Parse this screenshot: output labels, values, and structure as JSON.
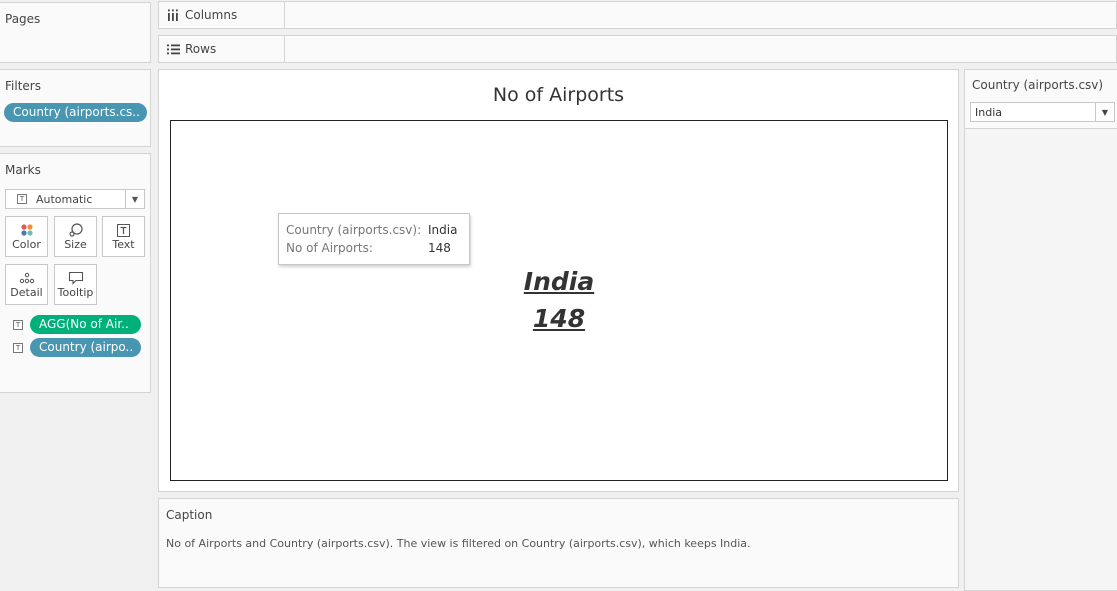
{
  "pages": {
    "title": "Pages"
  },
  "filters": {
    "title": "Filters",
    "pills": [
      {
        "label": "Country (airports.cs.."
      }
    ]
  },
  "marks": {
    "title": "Marks",
    "mark_type": "Automatic",
    "buttons": {
      "color": "Color",
      "size": "Size",
      "text": "Text",
      "detail": "Detail",
      "tooltip": "Tooltip"
    },
    "fields": [
      {
        "icon": "T",
        "label": "AGG(No of Air..",
        "color": "#00b07a"
      },
      {
        "icon": "T",
        "label": "Country (airpo..",
        "color": "#4996b2"
      }
    ]
  },
  "shelves": {
    "columns": "Columns",
    "rows": "Rows"
  },
  "viz": {
    "title": "No of Airports",
    "mark": {
      "country": "India",
      "value": "148"
    },
    "tooltip": {
      "rows": [
        {
          "key": "Country (airports.csv):",
          "value": "India"
        },
        {
          "key": "No of Airports:",
          "value": "148"
        }
      ]
    }
  },
  "caption": {
    "title": "Caption",
    "text": "No of Airports and Country (airports.csv). The view is filtered on Country (airports.csv), which keeps India."
  },
  "filter_card": {
    "title": "Country (airports.csv)",
    "selected": "India"
  },
  "colors": {
    "pill_blue": "#4996b2",
    "pill_green": "#00b07a"
  }
}
